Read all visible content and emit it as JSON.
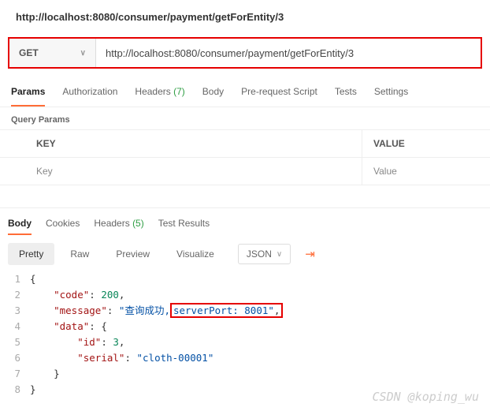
{
  "page_title": "http://localhost:8080/consumer/payment/getForEntity/3",
  "request": {
    "method": "GET",
    "url": "http://localhost:8080/consumer/payment/getForEntity/3"
  },
  "tabs": {
    "params": "Params",
    "auth": "Authorization",
    "headers_label": "Headers",
    "headers_count": "(7)",
    "body": "Body",
    "prerequest": "Pre-request Script",
    "tests": "Tests",
    "settings": "Settings"
  },
  "query_params": {
    "title": "Query Params",
    "key_header": "KEY",
    "value_header": "VALUE",
    "key_ph": "Key",
    "value_ph": "Value"
  },
  "resp_tabs": {
    "body": "Body",
    "cookies": "Cookies",
    "headers_label": "Headers",
    "headers_count": "(5)",
    "test_results": "Test Results"
  },
  "view": {
    "pretty": "Pretty",
    "raw": "Raw",
    "preview": "Preview",
    "visualize": "Visualize",
    "json": "JSON"
  },
  "response": {
    "code": 200,
    "message_prefix": "查询成功,",
    "message_highlight": "serverPort: 8001",
    "data_id": 3,
    "data_serial": "cloth-00001"
  },
  "watermark": "CSDN @koping_wu"
}
